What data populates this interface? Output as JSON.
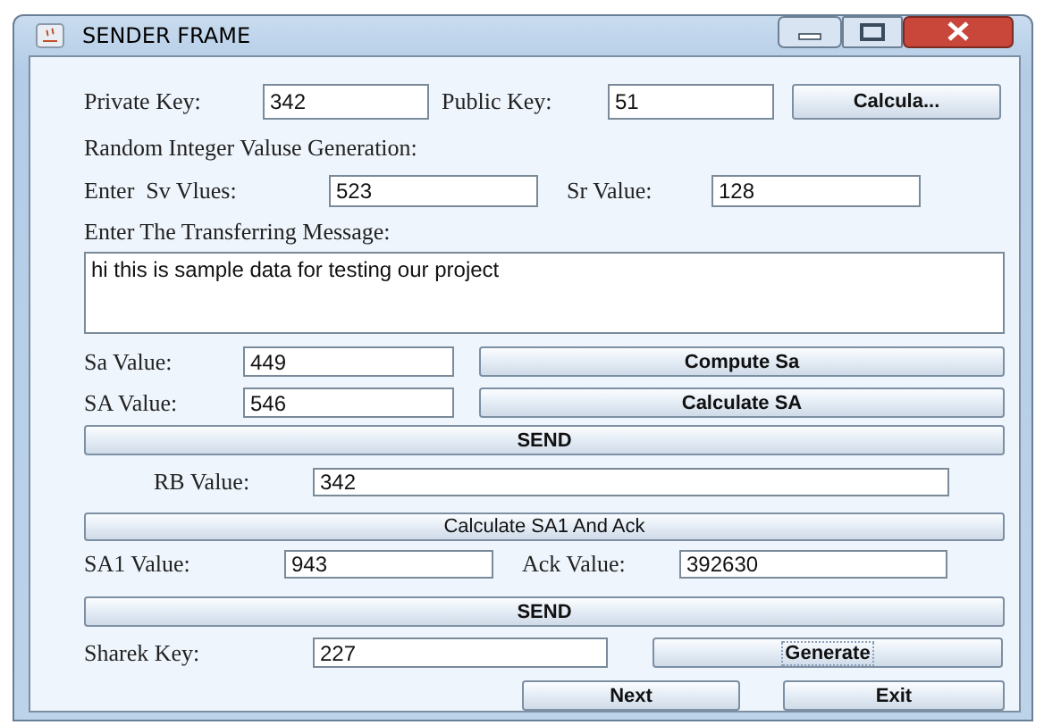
{
  "window": {
    "title": "SENDER FRAME"
  },
  "rows": [
    [
      {
        "kind": "label",
        "text": "Private Key:"
      },
      {
        "kind": "field",
        "value": "342"
      },
      {
        "kind": "label",
        "text": "Public Key:"
      },
      {
        "kind": "field",
        "value": "51"
      },
      {
        "kind": "button",
        "text": "Calcula...",
        "focused": false
      }
    ],
    [
      {
        "kind": "label",
        "text": "Random Integer Valuse Generation:"
      }
    ],
    [
      {
        "kind": "label",
        "text": "Enter  Sv Vlues:"
      },
      {
        "kind": "field",
        "value": "523"
      },
      {
        "kind": "label",
        "text": "Sr Value:"
      },
      {
        "kind": "field",
        "value": "128"
      }
    ],
    [
      {
        "kind": "label",
        "text": "Enter The Transferring Message:"
      }
    ],
    [
      {
        "kind": "textarea",
        "value": "hi this is sample data for testing our project"
      }
    ],
    [
      {
        "kind": "label",
        "text": "Sa Value:"
      },
      {
        "kind": "field",
        "value": "449"
      },
      {
        "kind": "button",
        "text": "Compute Sa",
        "focused": false
      }
    ],
    [
      {
        "kind": "label",
        "text": "SA Value:"
      },
      {
        "kind": "field",
        "value": "546"
      },
      {
        "kind": "button",
        "text": "Calculate SA",
        "focused": false
      }
    ],
    [
      {
        "kind": "button",
        "text": "SEND",
        "focused": false
      }
    ],
    [
      {
        "kind": "label",
        "text": "RB Value:"
      },
      {
        "kind": "field",
        "value": "342"
      }
    ],
    [
      {
        "kind": "button",
        "text": "Calculate SA1 And Ack",
        "focused": false
      }
    ],
    [
      {
        "kind": "label",
        "text": "SA1 Value:"
      },
      {
        "kind": "field",
        "value": "943"
      },
      {
        "kind": "label",
        "text": "Ack Value:"
      },
      {
        "kind": "field",
        "value": "392630"
      }
    ],
    [
      {
        "kind": "button",
        "text": "SEND",
        "focused": false
      }
    ],
    [
      {
        "kind": "label",
        "text": "Sharek Key:"
      },
      {
        "kind": "field",
        "value": "227"
      },
      {
        "kind": "button",
        "text": "Generate",
        "focused": true
      }
    ],
    [
      {
        "kind": "button",
        "text": "Next",
        "focused": false
      },
      {
        "kind": "button",
        "text": "Exit",
        "focused": false
      }
    ]
  ]
}
